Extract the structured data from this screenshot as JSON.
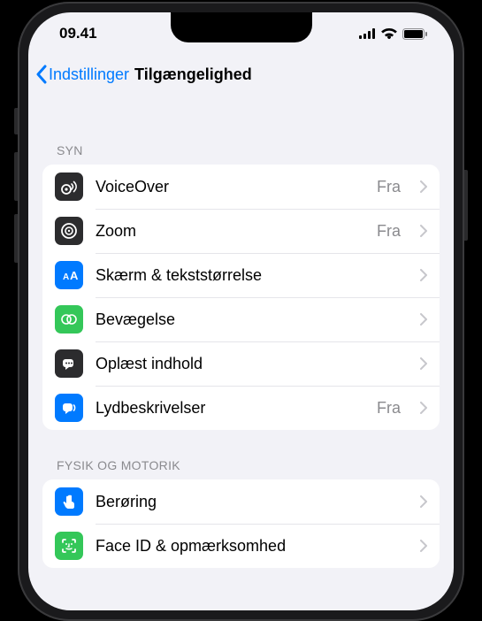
{
  "status": {
    "time": "09.41"
  },
  "nav": {
    "back_label": "Indstillinger",
    "title": "Tilgængelighed"
  },
  "sections": {
    "vision": {
      "header": "SYN",
      "items": {
        "voiceover": {
          "label": "VoiceOver",
          "value": "Fra"
        },
        "zoom": {
          "label": "Zoom",
          "value": "Fra"
        },
        "display": {
          "label": "Skærm & tekststørrelse"
        },
        "motion": {
          "label": "Bevægelse"
        },
        "spoken": {
          "label": "Oplæst indhold"
        },
        "audio_desc": {
          "label": "Lydbeskrivelser",
          "value": "Fra"
        }
      }
    },
    "motor": {
      "header": "FYSIK OG MOTORIK",
      "items": {
        "touch": {
          "label": "Berøring"
        },
        "faceid": {
          "label": "Face ID & opmærksomhed"
        }
      }
    }
  }
}
